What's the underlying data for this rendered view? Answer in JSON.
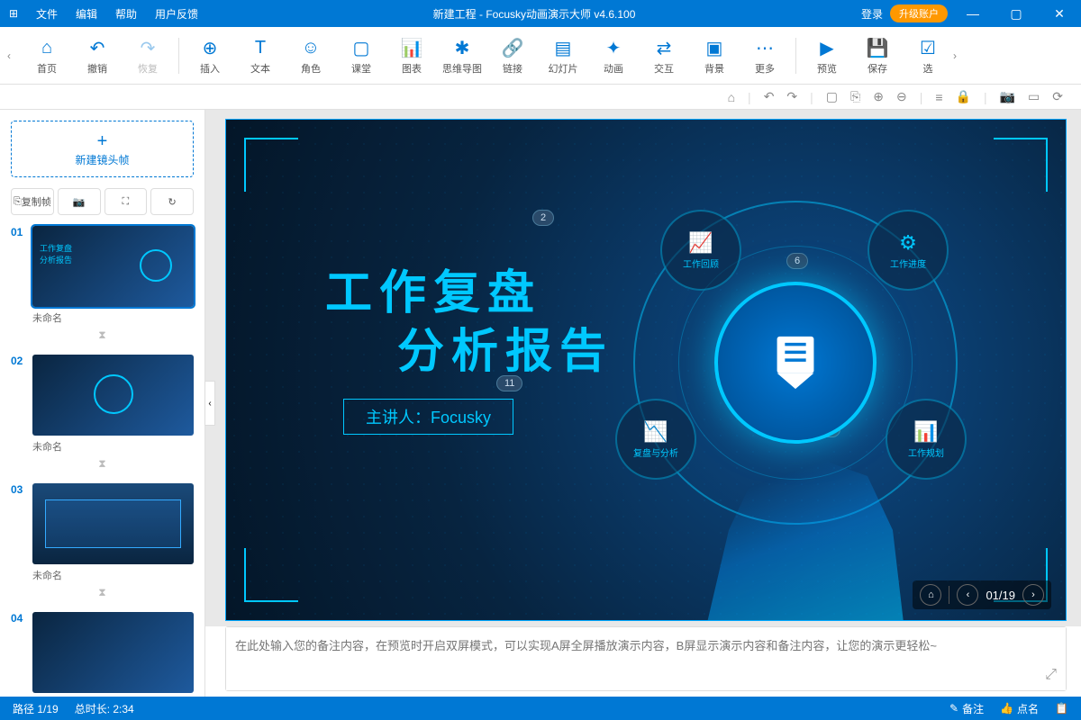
{
  "titlebar": {
    "menus": [
      "文件",
      "编辑",
      "帮助",
      "用户反馈"
    ],
    "title": "新建工程 - Focusky动画演示大师  v4.6.100",
    "login": "登录",
    "upgrade": "升级账户"
  },
  "toolbar": {
    "items": [
      {
        "icon": "⌂",
        "label": "首页"
      },
      {
        "icon": "↶",
        "label": "撤销"
      },
      {
        "icon": "↷",
        "label": "恢复",
        "disabled": true
      }
    ],
    "items2": [
      {
        "icon": "⊕",
        "label": "插入"
      },
      {
        "icon": "T",
        "label": "文本"
      },
      {
        "icon": "☺",
        "label": "角色"
      },
      {
        "icon": "▢",
        "label": "课堂"
      },
      {
        "icon": "📊",
        "label": "图表"
      },
      {
        "icon": "✱",
        "label": "思维导图"
      },
      {
        "icon": "🔗",
        "label": "链接"
      },
      {
        "icon": "▤",
        "label": "幻灯片"
      },
      {
        "icon": "✦",
        "label": "动画"
      },
      {
        "icon": "⇄",
        "label": "交互"
      },
      {
        "icon": "▣",
        "label": "背景"
      },
      {
        "icon": "⋯",
        "label": "更多"
      }
    ],
    "items3": [
      {
        "icon": "▶",
        "label": "预览"
      },
      {
        "icon": "💾",
        "label": "保存"
      },
      {
        "icon": "☑",
        "label": "选"
      }
    ]
  },
  "canvasbar_icons": [
    "⌂",
    "↶",
    "↷",
    "▢",
    "⎘",
    "⊕",
    "⊖",
    "≡",
    "🔒",
    "📷",
    "▭",
    "⟳"
  ],
  "sidebar": {
    "new_frame": "新建镜头帧",
    "copy_frame": "复制帧",
    "thumbs": [
      {
        "num": "01",
        "label": "未命名"
      },
      {
        "num": "02",
        "label": "未命名"
      },
      {
        "num": "03",
        "label": "未命名"
      },
      {
        "num": "04",
        "label": ""
      }
    ]
  },
  "slide": {
    "title1": "工作复盘",
    "title2": "分析报告",
    "presenter": "主讲人：Focusky",
    "badges": {
      "b1": "2",
      "b2": "6",
      "b3": "11",
      "b4": "15"
    },
    "nodes": [
      "工作回顾",
      "工作进度",
      "复盘与分析",
      "工作规划"
    ],
    "nav": "01/19"
  },
  "notes": {
    "placeholder": "在此处输入您的备注内容，在预览时开启双屏模式，可以实现A屏全屏播放演示内容，B屏显示演示内容和备注内容，让您的演示更轻松~"
  },
  "status": {
    "path": "路径 1/19",
    "duration": "总时长: 2:34",
    "note": "备注",
    "like": "点名"
  }
}
